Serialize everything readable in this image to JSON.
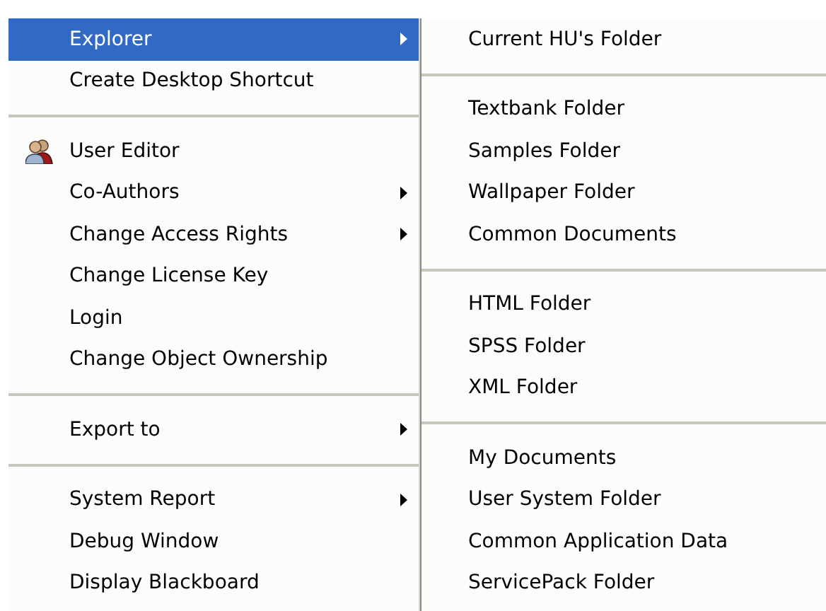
{
  "menu": {
    "items": [
      {
        "kind": "item",
        "label": "Explorer",
        "has_submenu": true,
        "selected": true,
        "has_icon": false
      },
      {
        "kind": "item",
        "label": "Create Desktop Shortcut",
        "has_submenu": false,
        "selected": false,
        "has_icon": false
      },
      {
        "kind": "separator"
      },
      {
        "kind": "item",
        "label": "User Editor",
        "has_submenu": false,
        "selected": false,
        "has_icon": true
      },
      {
        "kind": "item",
        "label": "Co-Authors",
        "has_submenu": true,
        "selected": false,
        "has_icon": false
      },
      {
        "kind": "item",
        "label": "Change Access Rights",
        "has_submenu": true,
        "selected": false,
        "has_icon": false
      },
      {
        "kind": "item",
        "label": "Change License Key",
        "has_submenu": false,
        "selected": false,
        "has_icon": false
      },
      {
        "kind": "item",
        "label": "Login",
        "has_submenu": false,
        "selected": false,
        "has_icon": false
      },
      {
        "kind": "item",
        "label": "Change Object Ownership",
        "has_submenu": false,
        "selected": false,
        "has_icon": false
      },
      {
        "kind": "separator"
      },
      {
        "kind": "item",
        "label": "Export to",
        "has_submenu": true,
        "selected": false,
        "has_icon": false
      },
      {
        "kind": "separator"
      },
      {
        "kind": "item",
        "label": "System Report",
        "has_submenu": true,
        "selected": false,
        "has_icon": false
      },
      {
        "kind": "item",
        "label": "Debug Window",
        "has_submenu": false,
        "selected": false,
        "has_icon": false
      },
      {
        "kind": "item",
        "label": "Display Blackboard",
        "has_submenu": false,
        "selected": false,
        "has_icon": false
      }
    ]
  },
  "submenu": {
    "items": [
      {
        "kind": "item",
        "label": "Current HU's Folder"
      },
      {
        "kind": "separator"
      },
      {
        "kind": "item",
        "label": "Textbank Folder"
      },
      {
        "kind": "item",
        "label": "Samples Folder"
      },
      {
        "kind": "item",
        "label": "Wallpaper Folder"
      },
      {
        "kind": "item",
        "label": "Common Documents"
      },
      {
        "kind": "separator"
      },
      {
        "kind": "item",
        "label": "HTML Folder"
      },
      {
        "kind": "item",
        "label": "SPSS Folder"
      },
      {
        "kind": "item",
        "label": "XML Folder"
      },
      {
        "kind": "separator"
      },
      {
        "kind": "item",
        "label": "My Documents"
      },
      {
        "kind": "item",
        "label": "User System Folder"
      },
      {
        "kind": "item",
        "label": "Common Application Data"
      },
      {
        "kind": "item",
        "label": "ServicePack Folder"
      }
    ]
  }
}
